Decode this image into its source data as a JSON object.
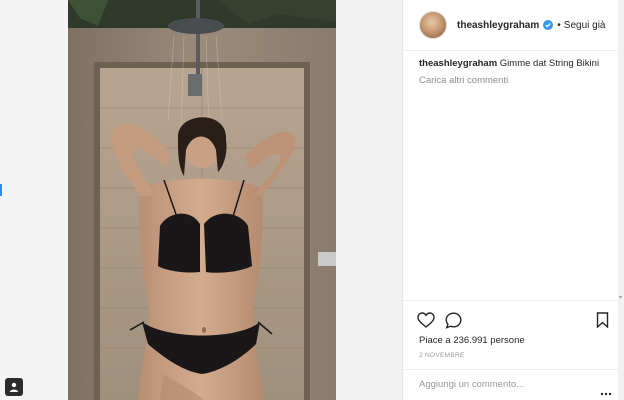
{
  "post": {
    "username": "theashleygraham",
    "follow_status": "Segui già",
    "separator": "•",
    "caption_user": "theashleygraham",
    "caption_text": "Gimme dat String Bikini",
    "load_more_comments": "Carica altri commenti",
    "likes_text": "Piace a 236.991 persone",
    "date": "2 NOVEMBRE",
    "comment_placeholder": "Aggiungi un commento..."
  },
  "icons": {
    "like": "heart-icon",
    "comment": "comment-bubble-icon",
    "save": "bookmark-icon",
    "more": "more-options-icon",
    "verified": "verified-badge-icon",
    "account": "account-badge-icon"
  },
  "colors": {
    "text": "#262626",
    "muted": "#8e8e8e",
    "verified_blue": "#3897f0",
    "background": "#f1f1f1"
  }
}
